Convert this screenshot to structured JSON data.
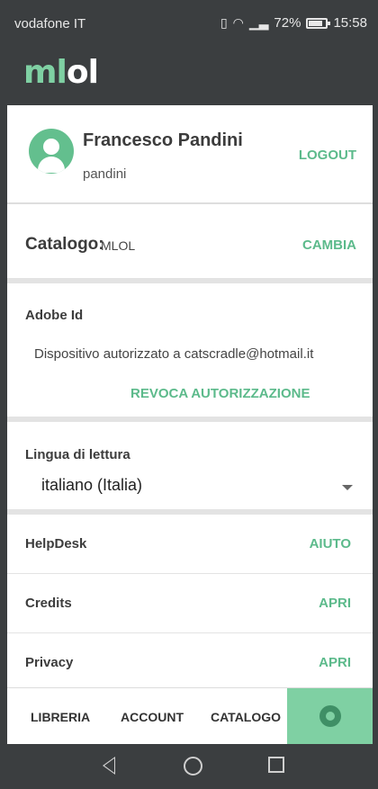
{
  "status_bar": {
    "carrier": "vodafone IT",
    "vibrate_icon": "vibrate-icon",
    "wifi_icon": "wifi-icon",
    "signal_icon": "signal-icon",
    "battery_percent": "72%",
    "time": "15:58"
  },
  "app": {
    "logo_part1": "ml",
    "logo_part2": "ol"
  },
  "profile": {
    "name": "Francesco Pandini",
    "username": "pandini",
    "logout_label": "LOGOUT",
    "avatar_icon": "user-avatar-icon"
  },
  "catalog": {
    "label": "Catalogo:",
    "value": "MLOL",
    "change_label": "CAMBIA"
  },
  "adobe": {
    "title": "Adobe Id",
    "device_text": "Dispositivo autorizzato a catscradle@hotmail.it",
    "revoke_label": "REVOCA AUTORIZZAZIONE"
  },
  "reading_language": {
    "title": "Lingua di lettura",
    "selected": "italiano (Italia)"
  },
  "rows": [
    {
      "label": "HelpDesk",
      "action": "AIUTO"
    },
    {
      "label": "Credits",
      "action": "APRI"
    },
    {
      "label": "Privacy",
      "action": "APRI"
    }
  ],
  "bottom_nav": {
    "library": "LIBRERIA",
    "account": "ACCOUNT",
    "catalog": "CATALOGO",
    "settings_icon": "gear-icon"
  },
  "colors": {
    "accent": "#5cba8b",
    "accent_light": "#7fd0a3",
    "dark_bar": "#3b3e40"
  }
}
